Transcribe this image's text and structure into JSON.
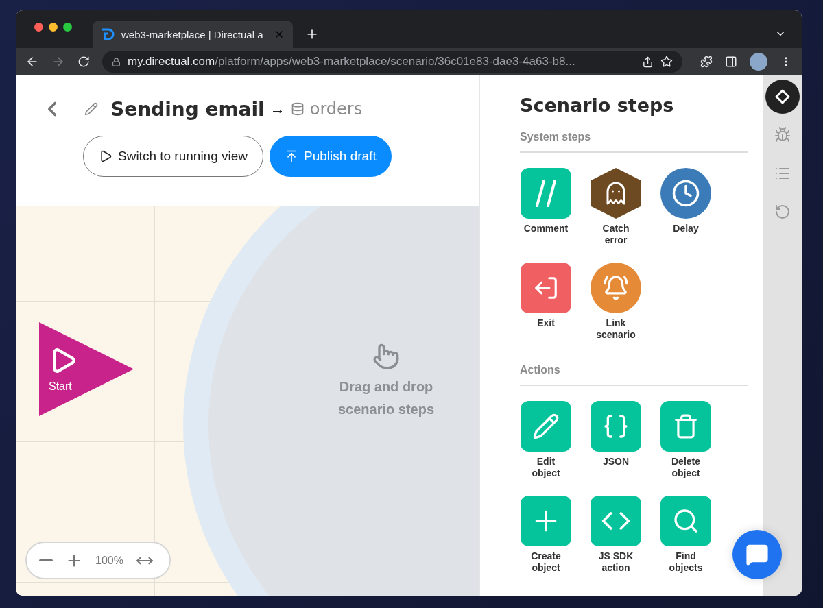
{
  "browser": {
    "tab_title": "web3-marketplace | Directual a",
    "url_host": "my.directual.com",
    "url_path": "/platform/apps/web3-marketplace/scenario/36c01e83-dae3-4a63-b8..."
  },
  "header": {
    "title": "Sending email",
    "arrow": "→",
    "table": "orders"
  },
  "buttons": [
    {
      "label": "Switch to running view",
      "kind": "outline"
    },
    {
      "label": "Publish draft",
      "kind": "primary"
    }
  ],
  "canvas": {
    "start_label": "Start",
    "drop_hint": "Drag and drop scenario steps",
    "zoom": "100%"
  },
  "panel": {
    "title": "Scenario steps",
    "sections": [
      {
        "title": "System steps",
        "steps": [
          {
            "label": "Comment",
            "kind": "square",
            "color": "#05c39a"
          },
          {
            "label": "Catch error",
            "kind": "hexagon",
            "color": "#6e4a22"
          },
          {
            "label": "Delay",
            "kind": "circle",
            "color": "#3b7bb7"
          },
          {
            "label": "Exit",
            "kind": "square",
            "color": "#f05f61"
          },
          {
            "label": "Link scenario",
            "kind": "circle",
            "color": "#e58a36"
          }
        ]
      },
      {
        "title": "Actions",
        "steps": [
          {
            "label": "Edit object",
            "kind": "square",
            "color": "#05c39a"
          },
          {
            "label": "JSON",
            "kind": "square",
            "color": "#05c39a"
          },
          {
            "label": "Delete object",
            "kind": "square",
            "color": "#05c39a"
          },
          {
            "label": "Create object",
            "kind": "square",
            "color": "#05c39a"
          },
          {
            "label": "JS SDK action",
            "kind": "square",
            "color": "#05c39a"
          },
          {
            "label": "Find objects",
            "kind": "square",
            "color": "#05c39a"
          }
        ]
      }
    ]
  },
  "rail": [
    {
      "selected": true
    },
    {
      "selected": false
    },
    {
      "selected": false
    },
    {
      "selected": false
    }
  ]
}
